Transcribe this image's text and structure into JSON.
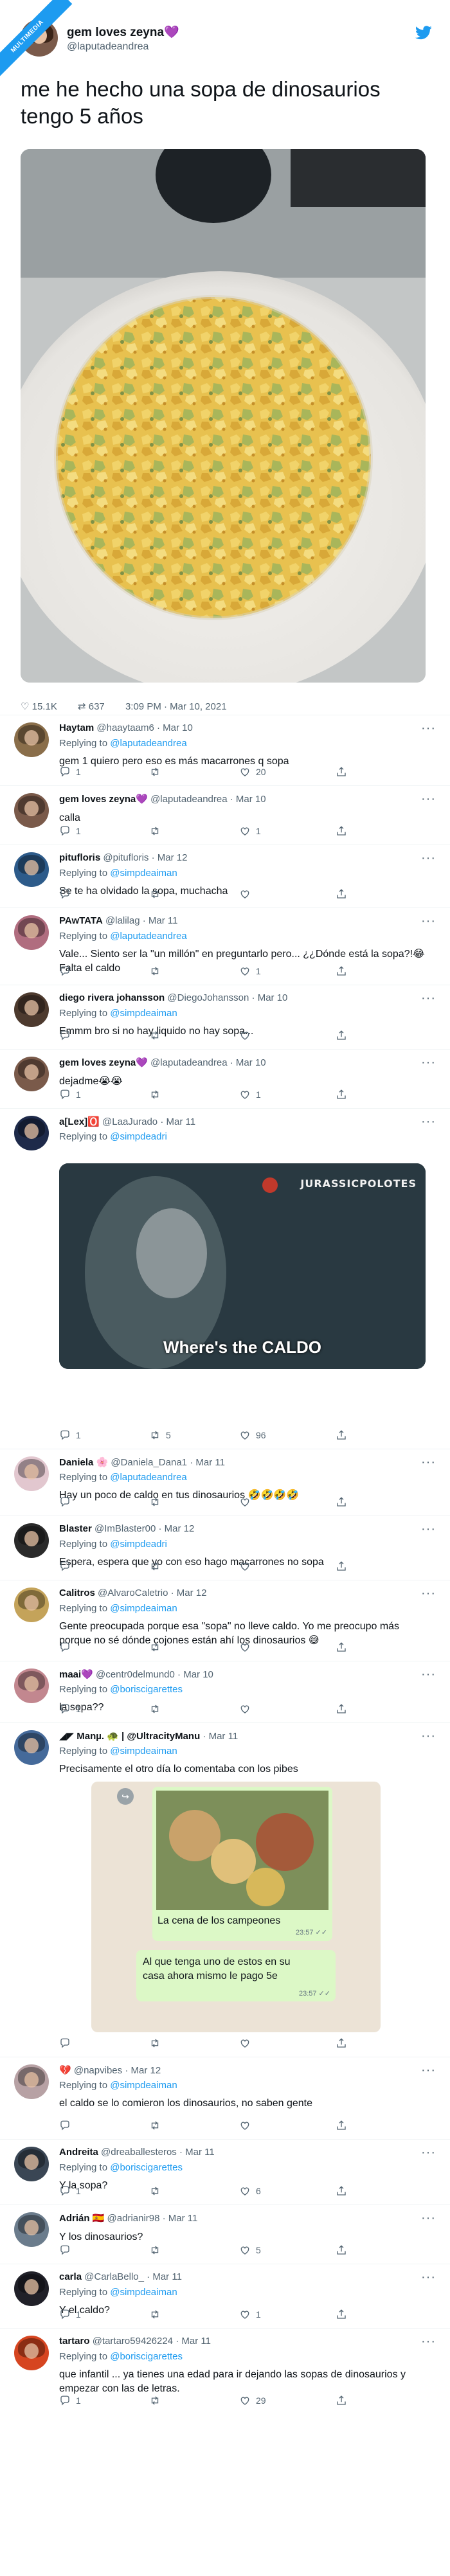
{
  "badge": "MULTIMEDIA",
  "main": {
    "author": "gem loves zeyna",
    "heart": "💜",
    "handle": "@laputadeandrea",
    "text": "me he hecho una sopa de dinosaurios tengo 5 años",
    "stats": {
      "likes": "15.1K",
      "retweets": "637",
      "time": "3:09 PM · Mar 10, 2021"
    }
  },
  "replies": [
    {
      "name": "Haytam",
      "handle": "@haaytaam6",
      "date": "· Mar 10",
      "replying_label": "Replying to",
      "replying_to": "@laputadeandrea",
      "text": "gem 1 quiero pero eso es más macarrones q sopa",
      "replies": "1",
      "retweets": "",
      "likes": "20"
    },
    {
      "name": "gem loves zeyna💜",
      "handle": "@laputadeandrea",
      "date": "· Mar 10",
      "text": "calla",
      "replies": "1",
      "retweets": "",
      "likes": "1"
    },
    {
      "name": "pitufloris",
      "handle": "@pitufloris",
      "date": "· Mar 12",
      "replying_label": "Replying to",
      "replying_to": "@simpdeaiman",
      "text": "Se te ha olvidado la sopa, muchacha",
      "replies": "",
      "retweets": "",
      "likes": ""
    },
    {
      "name": "PAwTATA",
      "handle": "@lalilag",
      "date": "· Mar 11",
      "replying_label": "Replying to",
      "replying_to": "@laputadeandrea",
      "text": "Vale... Siento ser la \"un millón\" en preguntarlo pero... ¿¿Dónde está la sopa?!😂 Falta el caldo",
      "replies": "",
      "retweets": "",
      "likes": "1"
    },
    {
      "name": "diego rivera johansson",
      "handle": "@DiegoJohansson",
      "date": "· Mar 10",
      "replying_label": "Replying to",
      "replying_to": "@simpdeaiman",
      "text": "Emmm bro si no hay liquido no hay sopa...",
      "replies": "",
      "retweets": "",
      "likes": ""
    },
    {
      "name": "gem loves zeyna💜",
      "handle": "@laputadeandrea",
      "date": "· Mar 10",
      "text": "dejadme😭😭",
      "replies": "1",
      "retweets": "",
      "likes": "1"
    },
    {
      "name": "a[Lex]🅾️",
      "handle": "@LaaJurado",
      "date": "· Mar 11",
      "replying_label": "Replying to",
      "replying_to": "@simpdeadri",
      "text": "",
      "media_caption": "Where's the CALDO",
      "media_brand": "JURASSICPOLOTES",
      "replies": "1",
      "retweets": "5",
      "likes": "96"
    },
    {
      "name": "Daniela 🌸",
      "handle": "@Daniela_Dana1",
      "date": "· Mar 11",
      "replying_label": "Replying to",
      "replying_to": "@laputadeandrea",
      "text": "Hay un poco de caldo en tus dinosaurios 🤣🤣🤣🤣",
      "replies": "",
      "retweets": "",
      "likes": ""
    },
    {
      "name": "Blaster",
      "handle": "@ImBlaster00",
      "date": "· Mar 12",
      "replying_label": "Replying to",
      "replying_to": "@simpdeadri",
      "text": "Espera, espera que yo con eso hago macarrones no sopa",
      "replies": "",
      "retweets": "",
      "likes": ""
    },
    {
      "name": "Calitros",
      "handle": "@AlvaroCaletrio",
      "date": "· Mar 12",
      "replying_label": "Replying to",
      "replying_to": "@simpdeaiman",
      "text": "Gente preocupada porque esa \"sopa\" no lleve caldo. Yo me preocupo más porque no sé dónde cojones están ahí los dinosaurios 😅",
      "replies": "",
      "retweets": "",
      "likes": ""
    },
    {
      "name": "maai💜",
      "handle": "@centr0delmund0",
      "date": "· Mar 10",
      "replying_label": "Replying to",
      "replying_to": "@boriscigarettes",
      "text": "la sopa??",
      "replies": "1",
      "retweets": "",
      "likes": ""
    },
    {
      "name": "◢◤ Manµ. 🐢 | @UltracityManu",
      "handle": "",
      "date": "· Mar 11",
      "replying_label": "Replying to",
      "replying_to": "@simpdeaiman",
      "text": "Precisamente el otro día lo comentaba con los pibes",
      "chat": {
        "msg1": "La cena de los campeones",
        "time1": "23:57 ✓✓",
        "msg2": "Al que tenga uno de estos en su casa ahora mismo le pago 5e",
        "time2": "23:57 ✓✓"
      },
      "replies": "",
      "retweets": "",
      "likes": ""
    },
    {
      "name": "💔",
      "handle": "@napvibes",
      "date": "· Mar 12",
      "replying_label": "Replying to",
      "replying_to": "@simpdeaiman",
      "text": "el caldo se lo comieron los dinosaurios, no saben gente",
      "replies": "",
      "retweets": "",
      "likes": ""
    },
    {
      "name": "Andreita",
      "handle": "@dreaballesteros",
      "date": "· Mar 11",
      "replying_label": "Replying to",
      "replying_to": "@boriscigarettes",
      "text": "Y la sopa?",
      "replies": "1",
      "retweets": "",
      "likes": "6"
    },
    {
      "name": "Adrián 🇪🇸",
      "handle": "@adrianir98",
      "date": "· Mar 11",
      "text": "Y los dinosaurios?",
      "replies": "",
      "retweets": "",
      "likes": "5"
    },
    {
      "name": "carla",
      "handle": "@CarlaBello_",
      "date": "· Mar 11",
      "replying_label": "Replying to",
      "replying_to": "@simpdeaiman",
      "text": "Y el caldo?",
      "replies": "1",
      "retweets": "",
      "likes": "1"
    },
    {
      "name": "tartaro",
      "handle": "@tartaro59426224",
      "date": "· Mar 11",
      "replying_label": "Replying to",
      "replying_to": "@boriscigarettes",
      "text": "que infantil ... ya tienes una edad para ir dejando las sopas de dinosaurios y empezar con las de letras.",
      "replies": "1",
      "retweets": "",
      "likes": "29"
    }
  ],
  "colors": {
    "accent": "#1d9bf0",
    "text": "#0f1419",
    "muted": "#536471"
  }
}
